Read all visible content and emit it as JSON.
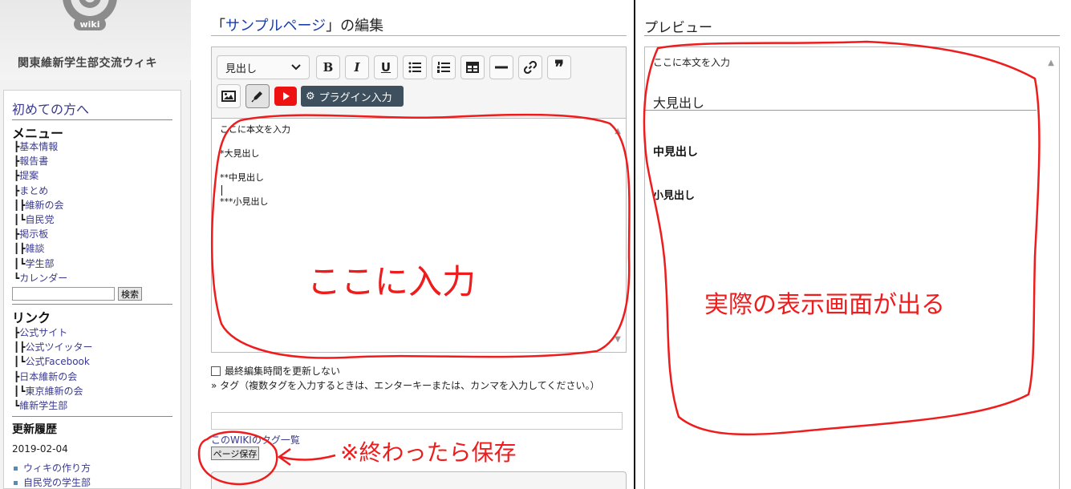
{
  "sidebar": {
    "logo_label": "wiki",
    "site_name": "関東維新学生部交流ウィキ",
    "first_link": "初めての方へ",
    "menu_title": "メニュー",
    "menu_items": [
      {
        "prefix": "┣",
        "label": "基本情報"
      },
      {
        "prefix": "┣",
        "label": "報告書"
      },
      {
        "prefix": "┣",
        "label": "提案"
      },
      {
        "prefix": "┣",
        "label": "まとめ"
      },
      {
        "prefix": "┃┣",
        "label": "維新の会"
      },
      {
        "prefix": "┃┗",
        "label": "自民党"
      },
      {
        "prefix": "┣",
        "label": "掲示板"
      },
      {
        "prefix": "┃┣",
        "label": "雑談"
      },
      {
        "prefix": "┃┗",
        "label": "学生部"
      },
      {
        "prefix": "┗",
        "label": "カレンダー"
      }
    ],
    "search_button": "検索",
    "links_title": "リンク",
    "link_items": [
      {
        "prefix": "┣",
        "label": "公式サイト"
      },
      {
        "prefix": "┃┣",
        "label": "公式ツイッター"
      },
      {
        "prefix": "┃┗",
        "label": "公式Facebook"
      },
      {
        "prefix": "┣",
        "label": "日本維新の会"
      },
      {
        "prefix": "┃┗",
        "label": "東京維新の会"
      },
      {
        "prefix": "┗",
        "label": "維新学生部"
      }
    ],
    "history_title": "更新履歴",
    "history_date": "2019-02-04",
    "history_items": [
      "ウィキの作り方",
      "自民党の学生部"
    ]
  },
  "editor": {
    "title_open": "「",
    "title_page": "サンプルページ",
    "title_close": "」の編集",
    "heading_select": "見出し",
    "toolbar": {
      "bold": "B",
      "italic": "I",
      "underline": "U",
      "quote": "❞"
    },
    "plugin_button": "プラグイン入力",
    "textarea_lines": [
      "ここに本文を入力",
      "",
      "*大見出し",
      "",
      "**中見出し",
      "",
      "***小見出し"
    ],
    "no_update_checkbox": "最終編集時間を更新しない",
    "tag_label": "» タグ（複数タグを入力するときは、エンターキーまたは、カンマを入力してください。）",
    "tag_list_link": "このWIKIのタグ一覧",
    "save_button": "ページ保存"
  },
  "preview": {
    "title": "プレビュー",
    "body": "ここに本文を入力",
    "h1": "大見出し",
    "h2": "中見出し",
    "h3": "小見出し"
  },
  "annotations": {
    "input_here": "ここに入力",
    "preview_note": "実際の表示画面が出る",
    "save_note": "※終わったら保存",
    "color": "#ee1c1c"
  },
  "icons": [
    "at-logo-icon",
    "bold-icon",
    "italic-icon",
    "underline-icon",
    "bullet-list-icon",
    "numbered-list-icon",
    "table-icon",
    "horizontal-rule-icon",
    "link-icon",
    "quote-icon",
    "image-icon",
    "pen-icon",
    "youtube-icon",
    "gear-icon",
    "chevron-down-icon"
  ]
}
